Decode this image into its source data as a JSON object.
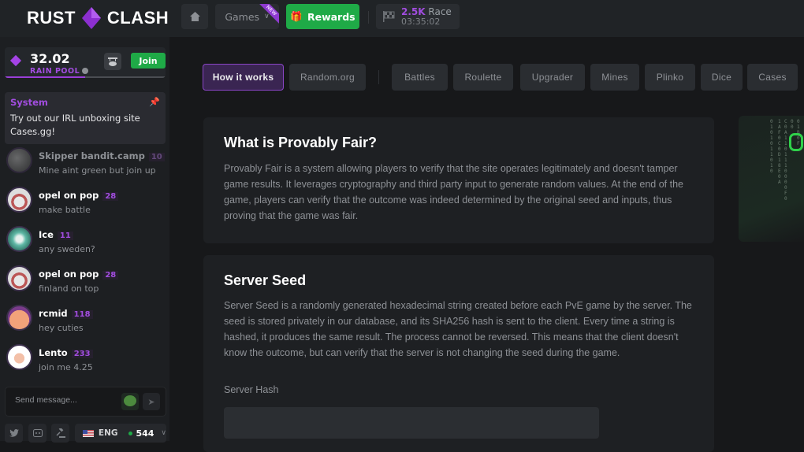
{
  "header": {
    "logo_left": "RUST",
    "logo_right": "CLASH",
    "home_icon": "home-icon",
    "games_label": "Games",
    "games_badge": "NEW",
    "rewards_label": "Rewards",
    "race": {
      "amount": "2.5K",
      "label": "Race",
      "timer": "03:35:02"
    }
  },
  "sidebar": {
    "rain": {
      "amount": "32.02",
      "label": "RAIN POOL",
      "join_label": "Join",
      "progress_fraction": 0.5
    },
    "system": {
      "title": "System",
      "message": "Try out our IRL unboxing site Cases.gg!"
    },
    "chat": [
      {
        "name": "Skipper bandit.camp",
        "level": "10",
        "message": "Mine aint green but join up",
        "dim": true
      },
      {
        "name": "opel on pop",
        "level": "28",
        "message": "make battle"
      },
      {
        "name": "Ice",
        "level": "11",
        "message": "any sweden?"
      },
      {
        "name": "opel on pop",
        "level": "28",
        "message": "finland on top"
      },
      {
        "name": "rcmid",
        "level": "118",
        "message": "hey cuties"
      },
      {
        "name": "Lento",
        "level": "233",
        "message": "join me 4.25"
      }
    ],
    "send_placeholder": "Send message...",
    "language": "ENG",
    "online_count": "544"
  },
  "main": {
    "tabs": [
      {
        "label": "How it works",
        "active": true
      },
      {
        "label": "Random.org"
      },
      {
        "label": "Battles"
      },
      {
        "label": "Roulette"
      },
      {
        "label": "Upgrader"
      },
      {
        "label": "Mines"
      },
      {
        "label": "Plinko"
      },
      {
        "label": "Dice"
      },
      {
        "label": "Cases"
      }
    ],
    "sections": [
      {
        "title": "What is Provably Fair?",
        "body": "Provably Fair is a system allowing players to verify that the site operates legitimately and doesn't tamper game results. It leverages cryptography and third party input to generate random values. At the end of the game, players can verify that the outcome was indeed determined by the original seed and inputs, thus proving that the game was fair."
      },
      {
        "title": "Server Seed",
        "body": "Server Seed is a randomly generated hexadecimal string created before each PvE game by the server. The seed is stored privately in our database, and its SHA256 hash is sent to the client. Every time a string is hashed, it produces the same result. The process cannot be reversed. This means that the client doesn't know the outcome, but can verify that the server is not changing the seed during the game.",
        "field_label": "Server Hash",
        "field_value": ""
      }
    ]
  },
  "colors": {
    "accent": "#a24de0",
    "green": "#1faa47",
    "bg": "#17181a",
    "panel": "#1e2023"
  }
}
